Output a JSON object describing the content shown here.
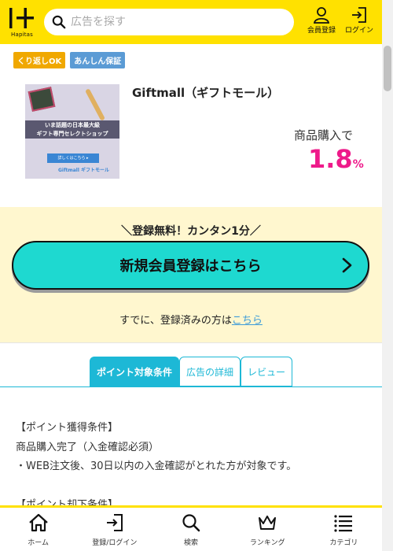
{
  "header": {
    "logo_text": "Hapitas",
    "search_placeholder": "広告を探す",
    "register_label": "会員登録",
    "login_label": "ログイン"
  },
  "badges": [
    "くり返しOK",
    "あんしん保証"
  ],
  "product": {
    "name": "Giftmall（ギフトモール）",
    "banner_line1": "いま話題の日本最大級",
    "banner_line2": "ギフト専門セレクトショップ",
    "banner_cta": "詳しくはこちら ▸",
    "banner_brand": "Giftmall ギフトモール",
    "point_label": "商品購入で",
    "point_value": "1.8",
    "point_unit": "%"
  },
  "register": {
    "free_text": "＼登録無料！カンタン1分／",
    "button_label": "新規会員登録はこちら",
    "already_text": "すでに、登録済みの方は",
    "already_link": "こちら"
  },
  "tabs": [
    {
      "label": "ポイント対象条件",
      "active": true
    },
    {
      "label": "広告の詳細",
      "active": false
    },
    {
      "label": "レビュー",
      "active": false
    }
  ],
  "conditions": {
    "heading1": "【ポイント獲得条件】",
    "line1": "商品購入完了（入金確認必須）",
    "line2": "・WEB注文後、30日以内の入金確認がとれた方が対象です。",
    "heading2": "【ポイント却下条件】"
  },
  "bottom_nav": [
    {
      "label": "ホーム",
      "icon": "home-icon"
    },
    {
      "label": "登録/ログイン",
      "icon": "login-icon"
    },
    {
      "label": "検索",
      "icon": "search-icon"
    },
    {
      "label": "ランキング",
      "icon": "crown-icon"
    },
    {
      "label": "カテゴリ",
      "icon": "menu-icon"
    }
  ],
  "colors": {
    "brand_yellow": "#ffe100",
    "point_pink": "#ee1a8a",
    "button_teal": "#1ed9d0",
    "tab_blue": "#1db8d6"
  }
}
